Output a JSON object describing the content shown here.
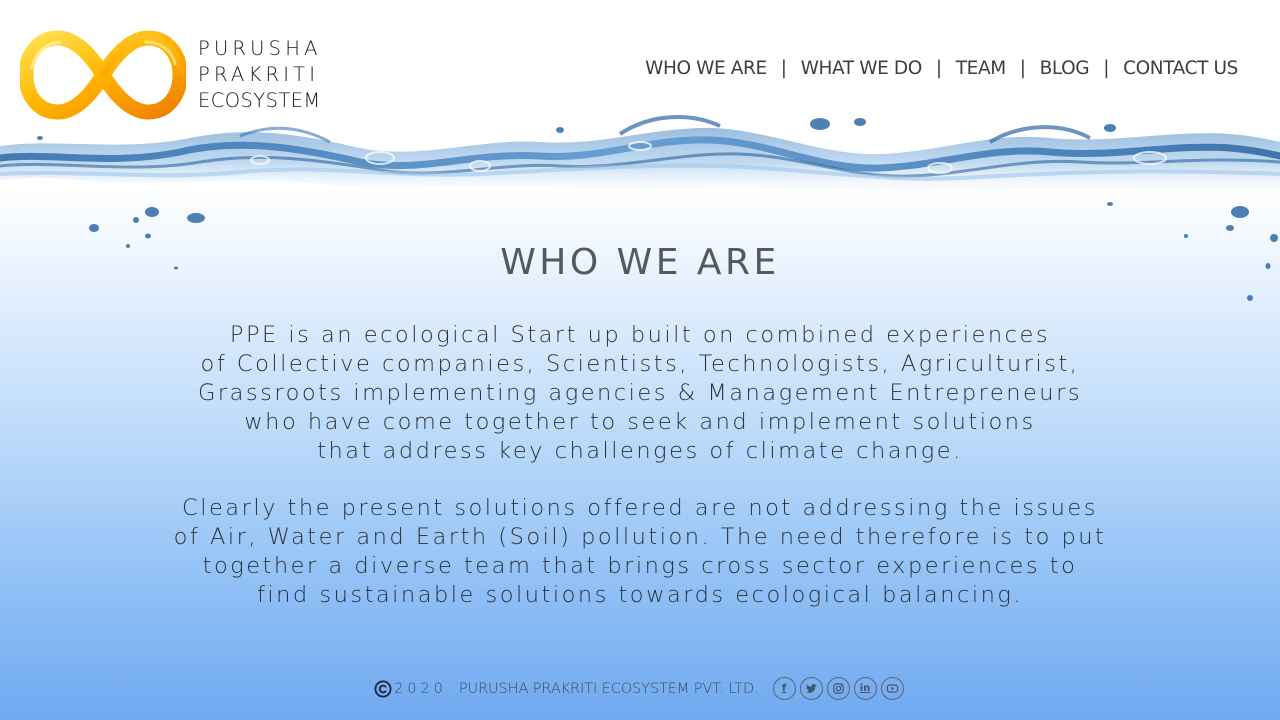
{
  "brand": {
    "lines": [
      "PURUSHA",
      "PRAKRITI",
      "ECOSYSTEM"
    ],
    "logo_icon": "infinity-icon",
    "logo_colors": [
      "#ffd23a",
      "#f7a400",
      "#ef8200"
    ]
  },
  "nav": {
    "items": [
      {
        "label": "WHO WE ARE"
      },
      {
        "label": "WHAT WE DO"
      },
      {
        "label": "TEAM"
      },
      {
        "label": "BLOG"
      },
      {
        "label": "CONTACT US"
      }
    ],
    "separator": "|"
  },
  "main": {
    "heading": "WHO WE ARE",
    "paragraph1": [
      "PPE is an ecological Start up built on combined experiences",
      "of Collective companies, Scientists, Technologists, Agriculturist,",
      "Grassroots implementing agencies & Management Entrepreneurs",
      "who have come together to seek and implement solutions",
      "that address key challenges of climate change."
    ],
    "paragraph2": [
      "Clearly the present solutions offered are not addressing the issues",
      "of Air, Water and Earth (Soil) pollution. The need therefore is to put",
      "together a diverse team that brings cross sector experiences to",
      "find sustainable solutions towards ecological balancing."
    ]
  },
  "footer": {
    "year": "2020",
    "company": "PURUSHA PRAKRITI ECOSYSTEM PVT. LTD.",
    "social": [
      {
        "name": "facebook-icon",
        "glyph": "f"
      },
      {
        "name": "twitter-icon",
        "glyph": ""
      },
      {
        "name": "instagram-icon",
        "glyph": ""
      },
      {
        "name": "linkedin-icon",
        "glyph": "in"
      },
      {
        "name": "youtube-icon",
        "glyph": ""
      }
    ]
  },
  "colors": {
    "text": "#2b3039",
    "heading": "#55585f",
    "water": "#3f7fbf",
    "bg_bottom": "#6fa9f0"
  }
}
